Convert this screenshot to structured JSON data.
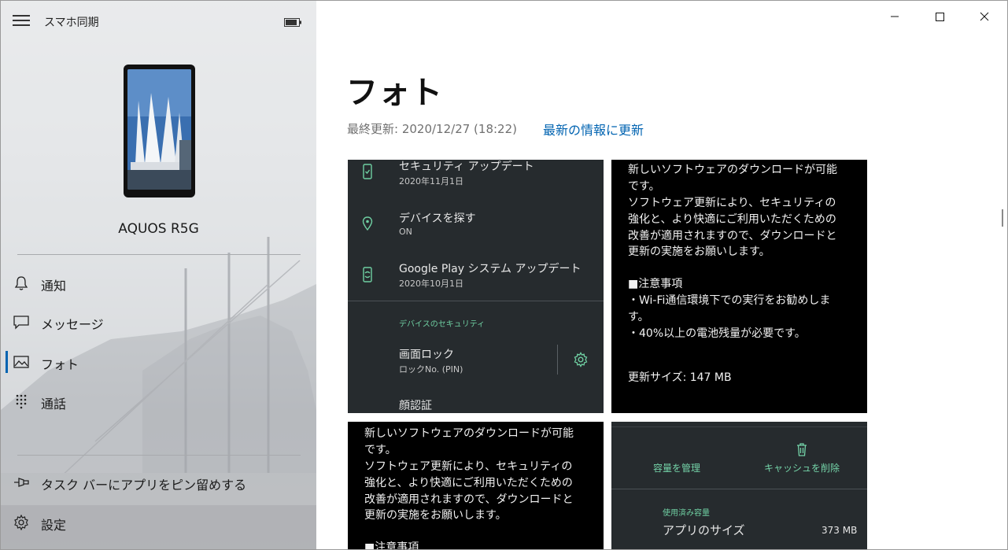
{
  "app": {
    "title": "スマホ同期"
  },
  "sidebar": {
    "device_name": "AQUOS R5G",
    "nav": [
      {
        "label": "通知",
        "icon": "bell-icon"
      },
      {
        "label": "メッセージ",
        "icon": "chat-icon"
      },
      {
        "label": "フォト",
        "icon": "photo-icon",
        "active": true
      },
      {
        "label": "通話",
        "icon": "dialpad-icon"
      }
    ],
    "pin_label": "タスク バーにアプリをピン留めする",
    "settings_label": "設定"
  },
  "main": {
    "title": "フォト",
    "last_updated": "最終更新: 2020/12/27 (18:22)",
    "refresh_label": "最新の情報に更新"
  },
  "tiles": {
    "security": {
      "rows": [
        {
          "title": "セキュリティ アップデート",
          "sub": "2020年11月1日",
          "icon": "phone-check-icon"
        },
        {
          "title": "デバイスを探す",
          "sub": "ON",
          "icon": "location-pin-icon"
        },
        {
          "title": "Google Play システム アップデート",
          "sub": "2020年10月1日",
          "icon": "phone-update-icon"
        }
      ],
      "section_heading": "デバイスのセキュリティ",
      "screen_lock_title": "画面ロック",
      "screen_lock_sub": "ロックNo. (PIN)",
      "face_auth": "顔認証",
      "gear_icon": "gear-icon",
      "accent_color": "#6fcfa2"
    },
    "update_text": {
      "lines": [
        "新しいソフトウェアのダウンロードが可能",
        "です。",
        "ソフトウェア更新により、セキュリティの",
        "強化と、より快適にご利用いただくための",
        "改善が適用されますので、ダウンロードと",
        "更新の実施をお願いします。",
        "",
        "■注意事項",
        "・Wi-Fi通信環境下での実行をお勧めしま",
        "す。",
        "・40%以上の電池残量が必要です。"
      ],
      "size_line": "更新サイズ: 147 MB"
    },
    "update_text_2": {
      "lines": [
        "新しいソフトウェアのダウンロードが可能",
        "です。",
        "ソフトウェア更新により、セキュリティの",
        "強化と、より快適にご利用いただくための",
        "改善が適用されますので、ダウンロードと",
        "更新の実施をお願いします。",
        "",
        "■注意事項"
      ]
    },
    "storage": {
      "manage_label": "容量を管理",
      "clear_cache_label": "キャッシュを削除",
      "used_heading": "使用済み容量",
      "app_size_label": "アプリのサイズ",
      "app_size_value": "373 MB"
    }
  }
}
